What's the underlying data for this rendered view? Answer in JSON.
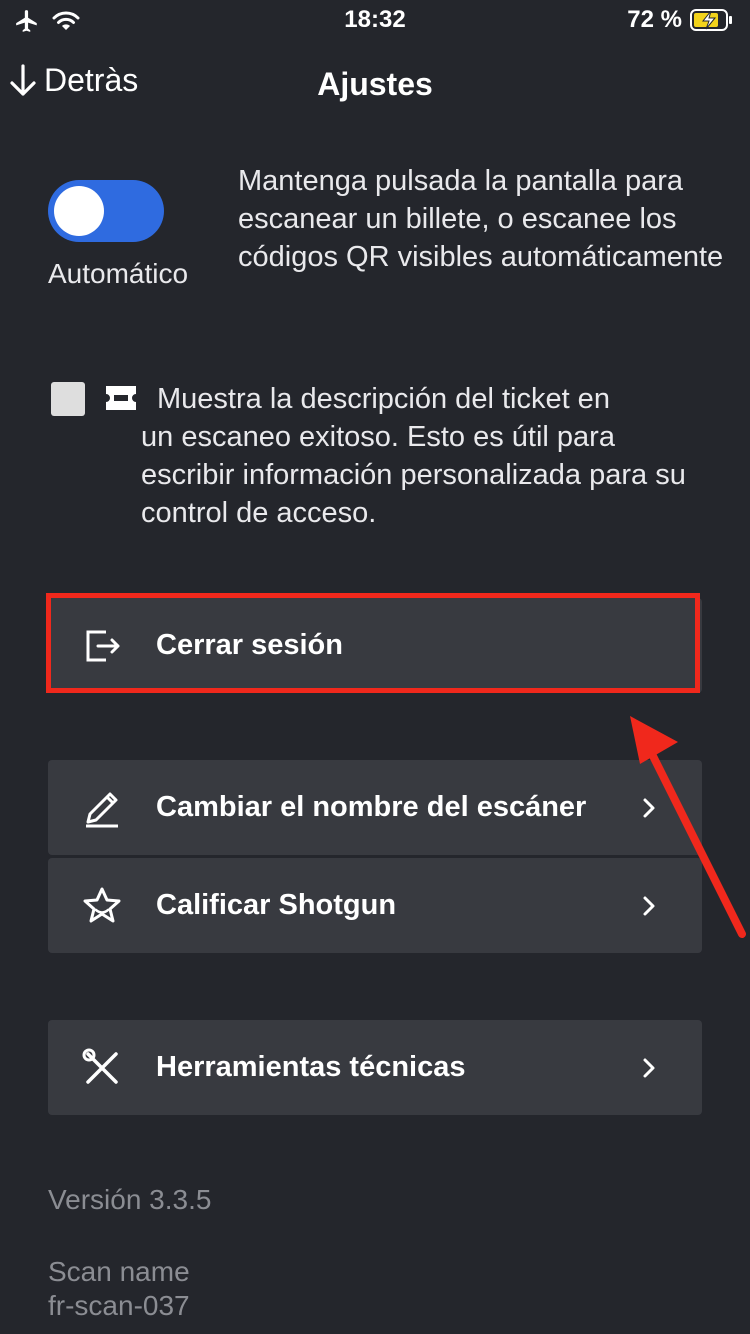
{
  "status_bar": {
    "time": "18:32",
    "battery": "72 %",
    "icons": [
      "airplane-icon",
      "wifi-icon",
      "battery-charging-icon"
    ]
  },
  "nav": {
    "back_label": "Detràs",
    "title": "Ajustes"
  },
  "auto_mode": {
    "label": "Automático",
    "enabled": true,
    "description": "Mantenga pulsada la pantalla para escanear un billete, o escanee los códigos QR visibles automáticamente"
  },
  "ticket_description": {
    "checked": false,
    "text_line1": "Muestra la descripción del ticket en",
    "text_rest": "un escaneo exitoso. Esto es útil para escribir información personalizada para su control de acceso."
  },
  "menu": {
    "logout": {
      "label": "Cerrar sesión",
      "icon": "logout-icon"
    },
    "rename": {
      "label": "Cambiar el nombre del escáner",
      "icon": "pencil-icon"
    },
    "rate": {
      "label": "Calificar Shotgun",
      "icon": "star-icon"
    },
    "tools": {
      "label": "Herramientas técnicas",
      "icon": "tools-icon"
    }
  },
  "footer": {
    "version": "Versión 3.3.5",
    "scan_name_label": "Scan name",
    "scan_name_value": "fr-scan-037"
  },
  "colors": {
    "background": "#24262c",
    "row_background": "#383a40",
    "toggle_on": "#2f6be0",
    "annotation_red": "#f0281c",
    "muted_text": "#8b8d93"
  }
}
